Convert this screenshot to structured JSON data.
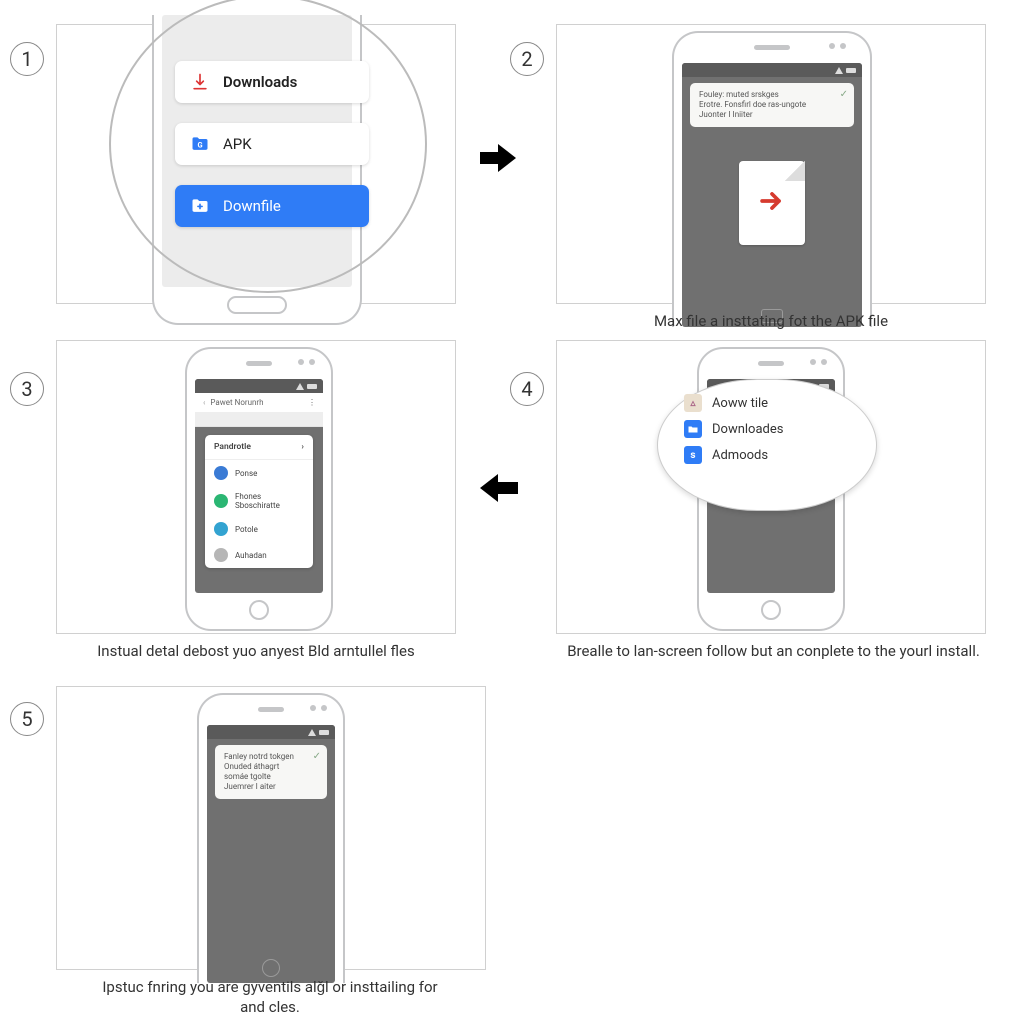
{
  "steps": {
    "s1": {
      "num": "1"
    },
    "s2": {
      "num": "2",
      "caption": "Max file a insttating fot the APK file"
    },
    "s3": {
      "num": "3",
      "caption": "Instual detal debost yuo anyest Bld arntullel fles"
    },
    "s4": {
      "num": "4",
      "caption": "Brealle to lan-screen follow but an conplete to the yourl install."
    },
    "s5": {
      "num": "5",
      "caption": "Ipstuc fnring you are gyventils alǧl or insttailing for and cles."
    }
  },
  "p1": {
    "items": [
      {
        "label": "Downloads"
      },
      {
        "label": "APK"
      },
      {
        "label": "Downfile"
      }
    ]
  },
  "p2": {
    "notif": {
      "line1": "Fouley: muted srskges",
      "line2": "Erotre. Fonsfirl doe ras-ungote",
      "line3": "Juonter I Iniiter"
    }
  },
  "p3": {
    "header": "Pawet Norunrh",
    "list_title": "Pandrotle",
    "rows": [
      {
        "label": "Ponse"
      },
      {
        "label": "Fhones Sboschiratte"
      },
      {
        "label": "Potole"
      },
      {
        "label": "Auhadan"
      }
    ]
  },
  "p4": {
    "rows": [
      {
        "label": "Aoww tile"
      },
      {
        "label": "Downloades"
      },
      {
        "label": "Admoods"
      }
    ]
  },
  "p5": {
    "notif": {
      "line1": "Fanley notrd tokgen",
      "line2": "Onuded áthagrt somáe tgolte",
      "line3": "Juemrer I aiter"
    }
  },
  "colors": {
    "blueFolder": "#2f7cf6",
    "green": "#2bb673",
    "teal": "#33a3d1",
    "grey": "#b6b6b6"
  }
}
